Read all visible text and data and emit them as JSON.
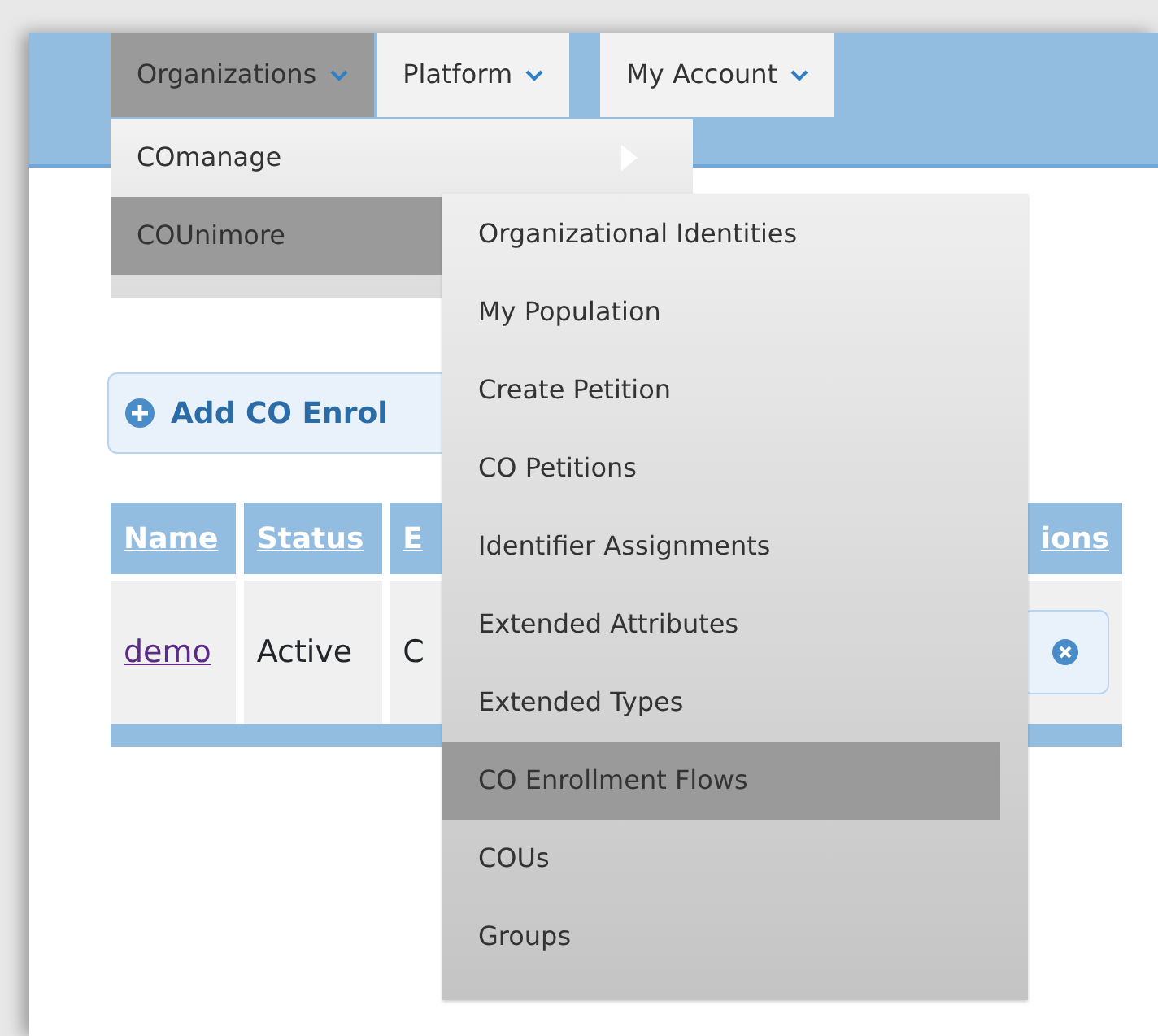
{
  "nav_tabs": [
    {
      "label": "Organizations",
      "selected": true
    },
    {
      "label": "Platform",
      "selected": false
    },
    {
      "label": "My Account",
      "selected": false
    }
  ],
  "organizations_menu": [
    {
      "label": "COmanage",
      "selected": false,
      "submenu": true
    },
    {
      "label": "COUnimore",
      "selected": true,
      "submenu": false
    }
  ],
  "co_submenu": [
    {
      "label": "Organizational Identities",
      "selected": false
    },
    {
      "label": "My Population",
      "selected": false
    },
    {
      "label": "Create Petition",
      "selected": false
    },
    {
      "label": "CO Petitions",
      "selected": false
    },
    {
      "label": "Identifier Assignments",
      "selected": false
    },
    {
      "label": "Extended Attributes",
      "selected": false
    },
    {
      "label": "Extended Types",
      "selected": false
    },
    {
      "label": "CO Enrollment Flows",
      "selected": true
    },
    {
      "label": "COUs",
      "selected": false
    },
    {
      "label": "Groups",
      "selected": false
    }
  ],
  "add_button": {
    "label": "Add CO Enrol"
  },
  "table": {
    "columns": [
      "Name",
      "Status",
      "E",
      "ions"
    ],
    "rows": [
      {
        "name": "demo",
        "status": "Active",
        "column_3": "C"
      }
    ]
  }
}
